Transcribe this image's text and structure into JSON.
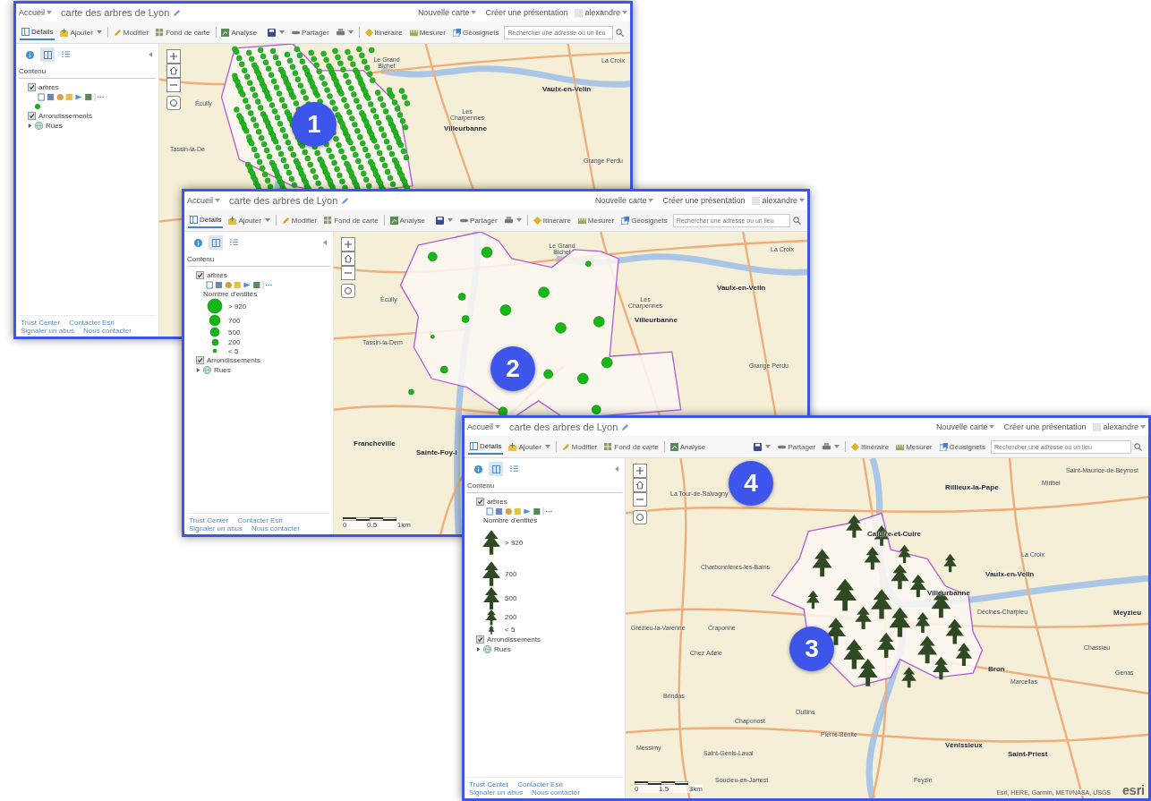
{
  "windows": [
    {
      "header": {
        "home": "Accueil",
        "title": "carte des arbres de Lyon",
        "new_map": "Nouvelle carte",
        "presentation": "Créer une présentation",
        "user": "alexandre"
      },
      "toolbar": {
        "details": {
          "label": "Détails",
          "selected": true
        },
        "add": "Ajouter",
        "modify": "Modifier",
        "basemap": "Fond de carte",
        "analysis": "Analyse",
        "share": "Partager",
        "route": "Itinéraire",
        "measure": "Mesurer",
        "bookmarks": "Géosignets",
        "search_placeholder": "Rechercher une adresse ou un lieu"
      },
      "sidebar": {
        "tabs": [
          {
            "selected": false
          },
          {
            "selected": true
          },
          {
            "selected": false
          }
        ],
        "heading": "Contenu",
        "layers": [
          {
            "kind": "checkbox",
            "name": "arbres",
            "checked": true
          },
          {
            "kind": "checkbox",
            "name": "Arrondissements",
            "checked": true
          },
          {
            "kind": "group",
            "name": "Rues",
            "expanded": false
          }
        ],
        "footer": [
          "Trust Center",
          "Contacter Esri",
          "Signaler un abus",
          "Nous contacter"
        ]
      },
      "map": {
        "labels": [
          {
            "text": "Le Grand Bichet",
            "major": false
          },
          {
            "text": "Vaulx-en-Velin",
            "major": true
          },
          {
            "text": "Les Charpennes",
            "major": false
          },
          {
            "text": "Villeurbanne",
            "major": true
          },
          {
            "text": "Écully",
            "major": false
          },
          {
            "text": "Tassin-la-De",
            "major": false
          },
          {
            "text": "La Croix",
            "major": false
          },
          {
            "text": "Grange Perdu",
            "major": false
          }
        ],
        "badges": [
          "1"
        ]
      }
    },
    {
      "header": {
        "home": "Accueil",
        "title": "carte des arbres de Lyon",
        "new_map": "Nouvelle carte",
        "presentation": "Créer une présentation",
        "user": "alexandre"
      },
      "toolbar": {
        "details": {
          "label": "Détails",
          "selected": true
        },
        "add": "Ajouter",
        "modify": "Modifier",
        "basemap": "Fond de carte",
        "analysis": "Analyse",
        "share": "Partager",
        "route": "Itinéraire",
        "measure": "Mesurer",
        "bookmarks": "Géosignets",
        "search_placeholder": "Rechercher une adresse ou un lieu"
      },
      "sidebar": {
        "tabs": [
          {
            "selected": false
          },
          {
            "selected": true
          },
          {
            "selected": false
          }
        ],
        "heading": "Contenu",
        "layers": [
          {
            "kind": "checkbox",
            "name": "arbres",
            "checked": true,
            "legend_title": "Nombre d'entités",
            "legend": [
              {
                "label": "> 920"
              },
              {
                "label": "700"
              },
              {
                "label": "500"
              },
              {
                "label": "200"
              },
              {
                "label": "< 5"
              }
            ]
          },
          {
            "kind": "checkbox",
            "name": "Arrondissements",
            "checked": true
          },
          {
            "kind": "group",
            "name": "Rues",
            "expanded": false
          }
        ],
        "footer": [
          "Trust Center",
          "Contacter Esri",
          "Signaler un abus",
          "Nous contacter"
        ]
      },
      "map": {
        "labels": [
          {
            "text": "Le Grand Bichet",
            "major": false
          },
          {
            "text": "Écully",
            "major": false
          },
          {
            "text": "Les Charpennes",
            "major": false
          },
          {
            "text": "Villeurbanne",
            "major": true
          },
          {
            "text": "Vaulx-en-Velin",
            "major": true
          },
          {
            "text": "La Croix",
            "major": false
          },
          {
            "text": "Tassin-la-Dem",
            "major": false
          },
          {
            "text": "Grange Perdu",
            "major": false
          },
          {
            "text": "Francheville",
            "major": true
          },
          {
            "text": "Sainte-Foy-l",
            "major": true
          }
        ],
        "scale": [
          "0",
          "0.5",
          "1km"
        ],
        "badges": [
          "2"
        ]
      }
    },
    {
      "header": {
        "home": "Accueil",
        "title": "carte des arbres de Lyon",
        "new_map": "Nouvelle carte",
        "presentation": "Créer une présentation",
        "user": "alexandre"
      },
      "toolbar": {
        "details": {
          "label": "Détails",
          "selected": true
        },
        "add": "Ajouter",
        "modify": "Modifier",
        "basemap": "Fond de carte",
        "analysis": "Analyse",
        "share": "Partager",
        "route": "Itinéraire",
        "measure": "Mesurer",
        "bookmarks": "Géosignets",
        "search_placeholder": "Rechercher une adresse ou un lieu"
      },
      "sidebar": {
        "tabs": [
          {
            "selected": false
          },
          {
            "selected": true
          },
          {
            "selected": false
          }
        ],
        "heading": "Contenu",
        "layers": [
          {
            "kind": "checkbox",
            "name": "arbres",
            "checked": true,
            "legend_title": "Nombre d'entités",
            "legend": [
              {
                "label": "> 920"
              },
              {
                "label": "700"
              },
              {
                "label": "500"
              },
              {
                "label": "200"
              },
              {
                "label": "< 5"
              }
            ]
          },
          {
            "kind": "checkbox",
            "name": "Arrondissements",
            "checked": true
          },
          {
            "kind": "group",
            "name": "Rues",
            "expanded": false
          }
        ],
        "footer": [
          "Trust Center",
          "Contacter Esri",
          "Signaler un abus",
          "Nous contacter"
        ]
      },
      "map": {
        "labels": [
          {
            "text": "La Tour-de-Salvagny",
            "major": false
          },
          {
            "text": "Rillieux-la-Pape",
            "major": true
          },
          {
            "text": "Saint-Maurice-de-Beynost",
            "major": false
          },
          {
            "text": "Miribel",
            "major": false
          },
          {
            "text": "Caluire-et-Cuire",
            "major": true
          },
          {
            "text": "Charbonnières-les-Bains",
            "major": false
          },
          {
            "text": "La Croix",
            "major": false
          },
          {
            "text": "Vaulx-en-Velin",
            "major": true
          },
          {
            "text": "Villeurbanne",
            "major": true
          },
          {
            "text": "Décines-Charpieu",
            "major": false
          },
          {
            "text": "Meyzieu",
            "major": true
          },
          {
            "text": "Grézieu-la-Varenne",
            "major": false
          },
          {
            "text": "Craponne",
            "major": false
          },
          {
            "text": "Chez Adèle",
            "major": false
          },
          {
            "text": "Chassieu",
            "major": false
          },
          {
            "text": "Bron",
            "major": true
          },
          {
            "text": "Marcellas",
            "major": false
          },
          {
            "text": "Genas",
            "major": false
          },
          {
            "text": "Brindas",
            "major": false
          },
          {
            "text": "Oullins",
            "major": false
          },
          {
            "text": "Chaponost",
            "major": false
          },
          {
            "text": "Pierre-Bénite",
            "major": false
          },
          {
            "text": "Vénissieux",
            "major": true
          },
          {
            "text": "Saint-Priest",
            "major": true
          },
          {
            "text": "Messimy",
            "major": false
          },
          {
            "text": "Saint-Genis-Laval",
            "major": false
          },
          {
            "text": "Soucieu-en-Jarrest",
            "major": false
          },
          {
            "text": "Feyzin",
            "major": false
          }
        ],
        "scale": [
          "0",
          "1.5",
          "3km"
        ],
        "attribution": "Esri, HERE, Garmin, METI/NASA, USGS",
        "logo": "esri",
        "badges": [
          "3",
          "4"
        ]
      }
    }
  ]
}
